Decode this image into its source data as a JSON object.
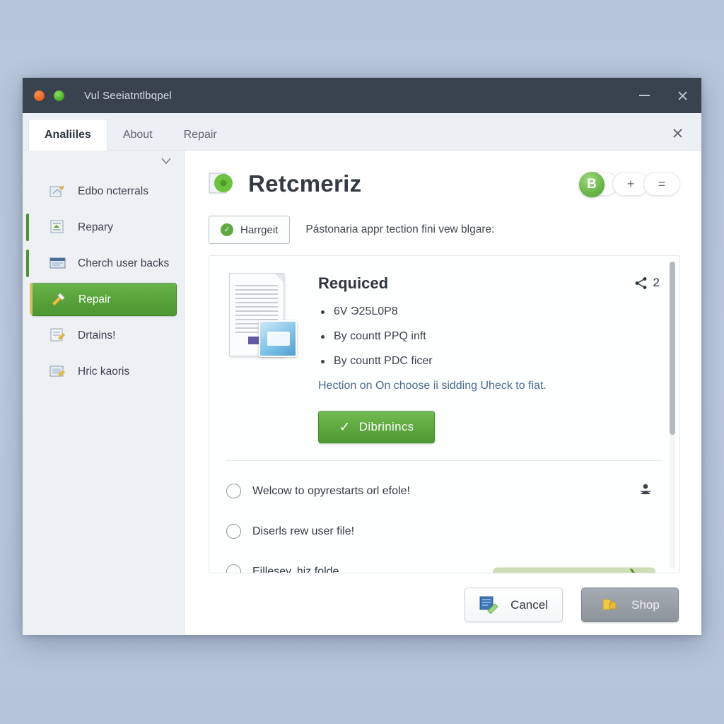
{
  "window": {
    "title": "Vul Seeiatntlbqpel",
    "minimize_label": "–",
    "close_label": "✕"
  },
  "tabs": [
    {
      "label": "Analiiles",
      "active": true
    },
    {
      "label": "About",
      "active": false
    },
    {
      "label": "Repair",
      "active": false
    }
  ],
  "tabbar": {
    "close_label": "✕"
  },
  "sidebar": {
    "caret_icon": "chevron-down-icon",
    "items": [
      {
        "label": "Edbo ncterrals",
        "icon": "export-icon",
        "accent": false,
        "active": false
      },
      {
        "label": "Repary",
        "icon": "archive-icon",
        "accent": true,
        "active": false
      },
      {
        "label": "Cherch user backs",
        "icon": "window-icon",
        "accent": true,
        "active": false
      },
      {
        "label": "Repair",
        "icon": "tools-icon",
        "accent": true,
        "active": true
      },
      {
        "label": "Drtains!",
        "icon": "note-icon",
        "accent": false,
        "active": false
      },
      {
        "label": "Hric kaoris",
        "icon": "folder-icon",
        "accent": false,
        "active": false
      }
    ]
  },
  "content": {
    "header_icon": "green-disc-icon",
    "title": "Retcmeriz",
    "toggles": [
      {
        "label": "B",
        "name": "toggle-b"
      },
      {
        "label": "+",
        "name": "toggle-plus"
      },
      {
        "label": "=",
        "name": "toggle-equals"
      }
    ],
    "status": {
      "badge_label": "Harrgeit",
      "badge_icon": "check-circle-icon",
      "text": "Pástonaria appr tection fini vew blgare:"
    },
    "card": {
      "thumbnail_icon": "document-image-icon",
      "title": "Requiced",
      "share_icon": "share-icon",
      "share_count": "2",
      "bullets": [
        "6V Э25L0P8",
        "By countt PPQ inft",
        "By countt PDC ficer"
      ],
      "note": "Hection on On choose ii sidding Uheck to fiat.",
      "cta_icon": "check-icon",
      "cta_label": "Dibrinincs",
      "options": [
        {
          "label": "Welcow to opyrestarts orl efole!",
          "trailing": "person-icon"
        },
        {
          "label": "Diserls rew user file!",
          "trailing": ""
        },
        {
          "label": "Eillesey, hiz folde...",
          "trailing": "progress-bar"
        }
      ],
      "progress_arrow_icon": "chevron-right-icon"
    }
  },
  "footer": {
    "cancel_icon": "restore-icon",
    "cancel_label": "Cancel",
    "shop_icon": "puzzle-icon",
    "shop_label": "Shop"
  },
  "colors": {
    "accent_green": "#5da83f",
    "title_bar": "#39424f",
    "selected_item": "#57a33a",
    "progress_track": "#cfdcb8"
  }
}
